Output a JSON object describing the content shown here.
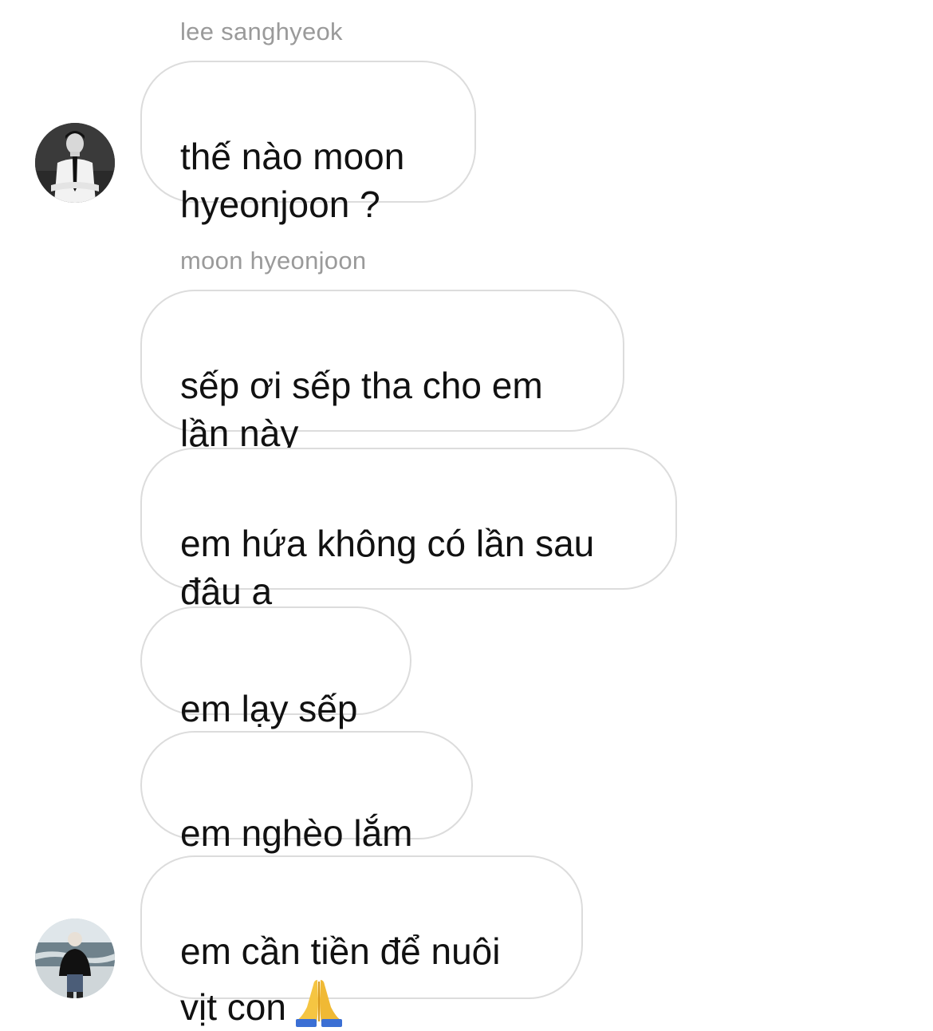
{
  "thread": {
    "sender_1": "lee sanghyeok",
    "sender_2": "moon hyeonjoon",
    "messages": [
      {
        "text": "thế nào moon\nhyeonjoon ?"
      },
      {
        "text": "sếp ơi sếp tha cho em\nlần này"
      },
      {
        "text": "em hứa không có lần sau\nđâu ạ"
      },
      {
        "text": "em lạy sếp"
      },
      {
        "text": "em nghèo lắm"
      },
      {
        "text": "em cần tiền để nuôi\nvịt con",
        "emoji": "folded-hands-emoji"
      }
    ]
  },
  "avatars": {
    "sender_1_avatar": "avatar-person-in-tie",
    "sender_2_avatar": "avatar-person-at-beach"
  },
  "colors": {
    "bubble_border": "#dcdcdc",
    "sender_name": "#9a9a9a",
    "message_text": "#111111",
    "background": "#ffffff"
  }
}
